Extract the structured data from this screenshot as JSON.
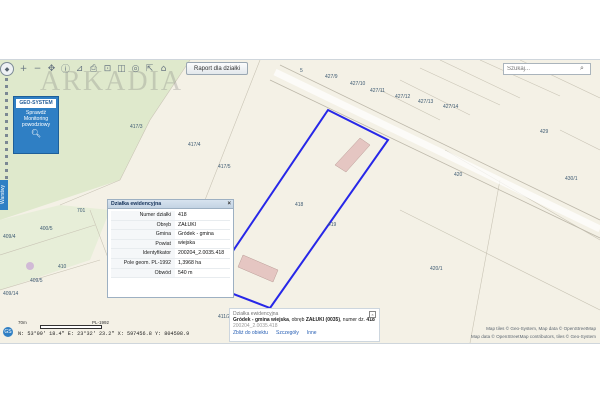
{
  "toolbar": {
    "report_button_label": "Raport dla działki",
    "search_placeholder": "Szukaj..."
  },
  "watermark": "ARKADIA",
  "geo_panel": {
    "logo": "GEO-SYSTEM",
    "line1": "Sprawdź",
    "line2": "Monitoring",
    "line3": "powodziowy"
  },
  "layers_tab_label": "Warstwy",
  "parcel_labels": [
    "427/9",
    "427/10",
    "427/11",
    "427/12",
    "427/13",
    "427/14",
    "417/3",
    "417/4",
    "417/5",
    "418",
    "419",
    "420",
    "420/1",
    "429",
    "430/1",
    "400/5",
    "409/4",
    "409/5",
    "410",
    "411/2",
    "427/8",
    "5",
    "409/14",
    "701"
  ],
  "popup_parcel": {
    "title": "Działka ewidencyjna",
    "rows": [
      {
        "label": "Numer działki",
        "value": "418"
      },
      {
        "label": "Obręb",
        "value": "ZAŁUKI"
      },
      {
        "label": "Gmina",
        "value": "Gródek - gmina wiejska"
      },
      {
        "label": "Powiat",
        "value": ""
      },
      {
        "label": "Identyfikator",
        "value": "200204_2.0035.418"
      },
      {
        "label": "Pole geom. PL-1992",
        "value": "1,3968 ha"
      },
      {
        "label": "Obwód",
        "value": "540 m"
      }
    ]
  },
  "popup_details": {
    "title": "Działka ewidencyjna",
    "line_gmina": "Gródek - gmina wiejska",
    "line_mid": ", obręb ",
    "line_obreb": "ZAŁUKI (0035)",
    "line_tail": ", numer dz. ",
    "line_num": "418",
    "identifier": "200204_2.0035.418",
    "links": [
      "Zbliż do obiektu",
      "Szczegóły",
      "Inne"
    ]
  },
  "attribution": {
    "line1": "Map tiles © Geo-System, Map data © OpenStreetMap",
    "line2": "Map data © OpenStreetMap contributors, tiles © Geo-System"
  },
  "status_bar": {
    "coordinates": "N: 53°09' 18.4\"  E: 23°32' 23.2\"  X: 597456.8  Y: 804508.9",
    "scale": "70m",
    "projection": "PL-1992"
  },
  "colors": {
    "selected_parcel": "#2727e8",
    "panel_blue": "#2f7fc4",
    "road": "#ffffff",
    "meadow": "#dfe9cc"
  }
}
